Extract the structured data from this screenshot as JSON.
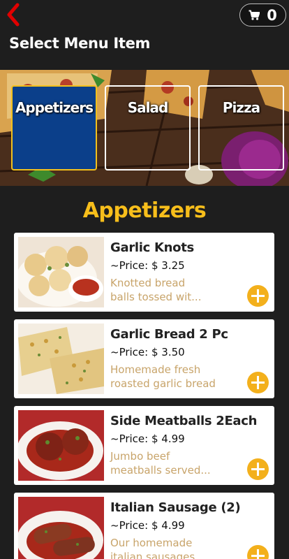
{
  "header": {
    "title": "Select Menu Item",
    "cart_count": "0",
    "back_icon": "chevron-left-icon",
    "cart_icon": "shopping-cart-icon"
  },
  "categories": [
    {
      "label": "Appetizers",
      "active": true
    },
    {
      "label": "Salad",
      "active": false
    },
    {
      "label": "Pizza",
      "active": false
    }
  ],
  "section": {
    "heading": "Appetizers"
  },
  "items": [
    {
      "name": "Garlic Knots",
      "price": "~Price: $ 3.25",
      "description_1": "Knotted bread",
      "description_2": "balls tossed wit..."
    },
    {
      "name": "Garlic Bread 2 Pc",
      "price": "~Price: $ 3.50",
      "description_1": "Homemade fresh",
      "description_2": "roasted garlic bread"
    },
    {
      "name": "Side Meatballs 2Each",
      "price": "~Price: $ 4.99",
      "description_1": "Jumbo beef",
      "description_2": "meatballs served..."
    },
    {
      "name": "Italian Sausage (2)",
      "price": "~Price: $ 4.99",
      "description_1": "Our homemade",
      "description_2": "italian sausages"
    }
  ],
  "colors": {
    "accent": "#f7be1b",
    "active_tile": "#0b3f8a",
    "back_arrow": "#e00000",
    "description": "#c8a46a"
  }
}
